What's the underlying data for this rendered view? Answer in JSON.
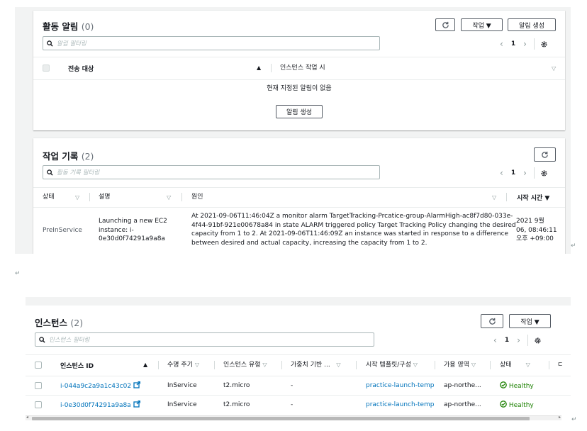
{
  "alarms": {
    "title": "활동 알림",
    "count": "(0)",
    "refresh_icon": "refresh-icon",
    "actions_label": "작업 ▼",
    "create_label": "알림 생성",
    "search_placeholder": "알림 필터링",
    "page": "1",
    "col_target": "전송 대상",
    "col_when": "인스턴스 작업 시",
    "empty_text": "현재 지정된 알림이 없음",
    "empty_create_label": "알림 생성"
  },
  "history": {
    "title": "작업 기록",
    "count": "(2)",
    "search_placeholder": "활동 기록 필터링",
    "page": "1",
    "col_status": "상태",
    "col_desc": "설명",
    "col_cause": "원인",
    "col_start": "시작 시간 ▼",
    "row": {
      "status": "PreInService",
      "desc": [
        "Launching a new EC2",
        "instance: i-",
        "0e30d0f74291a9a8a"
      ],
      "cause": [
        "At 2021-09-06T11:46:04Z a monitor alarm TargetTracking-Prcatice-group-AlarmHigh-ac8f7d80-033e-",
        "4f44-91bf-921e00678a84 in state ALARM triggered policy Target Tracking Policy changing the desired",
        "capacity from 1 to 2. At 2021-09-06T11:46:09Z an instance was started in response to a difference",
        "between desired and actual capacity, increasing the capacity from 1 to 2."
      ],
      "start": [
        "2021 9월",
        "06, 08:46:11",
        "오후 +09:00"
      ]
    }
  },
  "instances": {
    "title": "인스턴스",
    "count": "(2)",
    "actions_label": "작업 ▼",
    "search_placeholder": "인스턴스 필터링",
    "page": "1",
    "columns": [
      "인스턴스 ID",
      "수명 주기",
      "인스턴스 유형",
      "가중치 기반 ...",
      "시작 템플릿/구성",
      "가용 영역",
      "상태",
      "ㄷ"
    ],
    "rows": [
      {
        "id": "i-044a9c2a9a1c43c02",
        "lifecycle": "InService",
        "type": "t2.micro",
        "weight": "-",
        "template": "practice-launch-templa",
        "az": "ap-northe...",
        "health": "Healthy"
      },
      {
        "id": "i-0e30d0f74291a9a8a",
        "lifecycle": "InService",
        "type": "t2.micro",
        "weight": "-",
        "template": "practice-launch-templa",
        "az": "ap-northe...",
        "health": "Healthy"
      }
    ]
  },
  "doc": {
    "return_mark": "↵"
  }
}
